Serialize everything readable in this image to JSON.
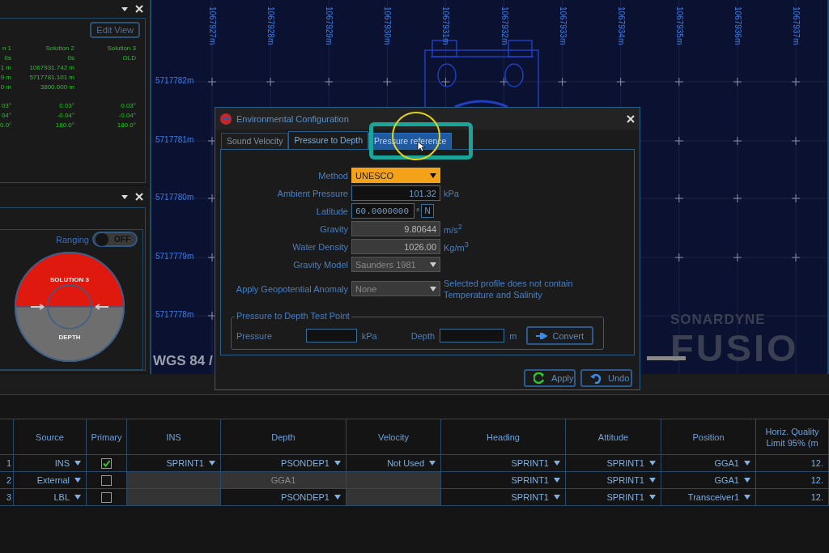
{
  "solutions_panel": {
    "edit_view_button": "Edit View",
    "columns": [
      "n 1",
      "Solution 2",
      "Solution 3"
    ],
    "position_rows": [
      [
        "0s",
        "0s",
        "OLD"
      ],
      [
        "1 m",
        "1067931.742 m"
      ],
      [
        "9 m",
        "5717781.101 m"
      ],
      [
        "0 m",
        "3800.000 m"
      ]
    ],
    "attitude_rows": [
      [
        "03°",
        "0.03°",
        "0.03°"
      ],
      [
        "04°",
        "-0.04°",
        "-0.04°"
      ],
      [
        "0.0°",
        "180.0°",
        "180.0°"
      ]
    ]
  },
  "ranging_panel": {
    "toggle_label": "Ranging",
    "toggle": {
      "on": false,
      "label": "OFF"
    },
    "gauge": {
      "top_label": "SOLUTION 3",
      "bottom_label": "DEPTH"
    }
  },
  "map": {
    "x_labels": [
      "1067927m",
      "1067928m",
      "1067929m",
      "1067930m",
      "1067931m",
      "1067932m",
      "1067933m",
      "1067934m",
      "1067935m",
      "1067936m",
      "1067937m"
    ],
    "y_labels": [
      "5717782m",
      "5717781m",
      "5717780m",
      "5717779m",
      "5717778m"
    ],
    "crs_label": "WGS 84 /",
    "logo": {
      "brand": "SONARDYNE",
      "product": "FUSIO"
    }
  },
  "dialog": {
    "title": "Environmental Configuration",
    "tabs": [
      {
        "label": "Sound Velocity",
        "selected": false,
        "hovered": false
      },
      {
        "label": "Pressure to Depth",
        "selected": true,
        "hovered": false
      },
      {
        "label": "Pressure reference",
        "selected": false,
        "hovered": true
      }
    ],
    "fields": [
      {
        "label": "Method",
        "kind": "dropdown",
        "value": "UNESCO",
        "highlighted": true
      },
      {
        "label": "Ambient Pressure",
        "kind": "input",
        "value": "101.32",
        "unit": "kPa"
      },
      {
        "label": "Latitude",
        "kind": "latitude",
        "value": "60.0000000",
        "unit": "°",
        "hemisphere": "N"
      },
      {
        "label": "Gravity",
        "kind": "readonly",
        "value": "9.80644",
        "unit": "m/s$^{2}$"
      },
      {
        "label": "Water Density",
        "kind": "readonly",
        "value": "1026.00",
        "unit": "Kg/m$^{3}$"
      },
      {
        "label": "Gravity Model",
        "kind": "dropdown",
        "value": "Saunders 1981",
        "highlighted": false
      },
      {
        "label": "Apply Geopotential Anomaly",
        "kind": "dropdown",
        "value": "None",
        "highlighted": false,
        "note": "Selected profile does not contain Temperature and Salinity"
      }
    ],
    "test_point": {
      "legend": "Pressure to Depth Test Point",
      "pressure_label": "Pressure",
      "pressure_unit": "kPa",
      "depth_label": "Depth",
      "depth_unit": "m",
      "convert_button": "Convert"
    },
    "buttons": [
      {
        "label": "Apply",
        "kind": "apply"
      },
      {
        "label": "Undo",
        "kind": "undo"
      }
    ]
  },
  "sources_table": {
    "columns": [
      "Source",
      "Primary",
      "INS",
      "Depth",
      "Velocity",
      "Heading",
      "Attitude",
      "Position",
      "Horiz. Quality\nLimit 95% (m"
    ],
    "rows": [
      {
        "number": "1",
        "cells": [
          {
            "kind": "dropdown",
            "value": "INS"
          },
          {
            "kind": "checkbox",
            "checked": true
          },
          {
            "kind": "dropdown",
            "value": "SPRINT1"
          },
          {
            "kind": "dropdown",
            "value": "PSONDEP1"
          },
          {
            "kind": "dropdown",
            "value": "Not Used"
          },
          {
            "kind": "dropdown",
            "value": "SPRINT1"
          },
          {
            "kind": "dropdown",
            "value": "SPRINT1"
          },
          {
            "kind": "dropdown",
            "value": "GGA1"
          },
          {
            "kind": "text",
            "value": "12."
          }
        ]
      },
      {
        "number": "2",
        "cells": [
          {
            "kind": "dropdown",
            "value": "External"
          },
          {
            "kind": "checkbox",
            "checked": false
          },
          {
            "kind": "blank"
          },
          {
            "kind": "readonly",
            "value": "GGA1"
          },
          {
            "kind": "blank"
          },
          {
            "kind": "dropdown",
            "value": "SPRINT1"
          },
          {
            "kind": "dropdown",
            "value": "SPRINT1"
          },
          {
            "kind": "dropdown",
            "value": "GGA1"
          },
          {
            "kind": "text",
            "value": "12."
          }
        ]
      },
      {
        "number": "3",
        "cells": [
          {
            "kind": "dropdown",
            "value": "LBL"
          },
          {
            "kind": "checkbox",
            "checked": false
          },
          {
            "kind": "blank"
          },
          {
            "kind": "dropdown",
            "value": "PSONDEP1"
          },
          {
            "kind": "blank"
          },
          {
            "kind": "dropdown",
            "value": "SPRINT1"
          },
          {
            "kind": "dropdown",
            "value": "SPRINT1"
          },
          {
            "kind": "dropdown",
            "value": "Transceiver1"
          },
          {
            "kind": "text",
            "value": "12."
          }
        ]
      }
    ]
  }
}
